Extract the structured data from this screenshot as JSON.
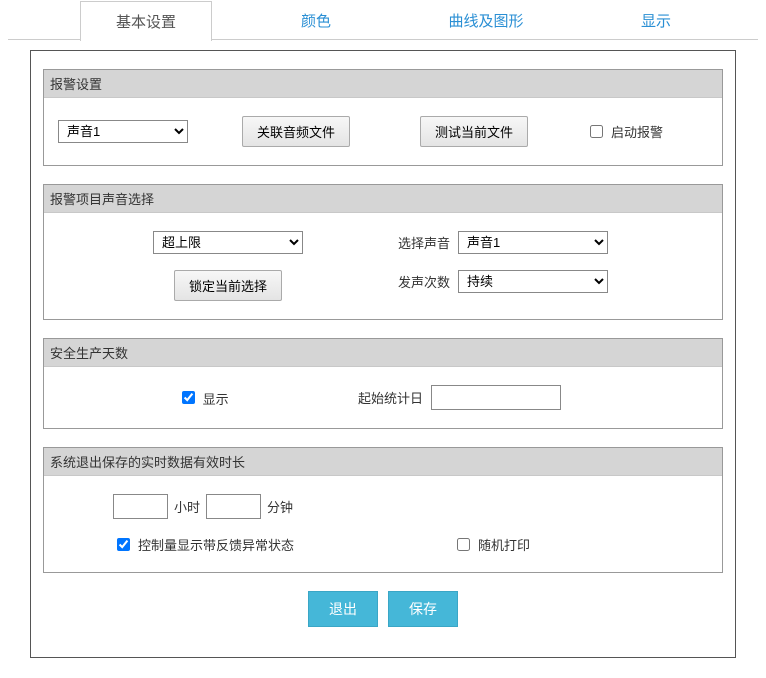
{
  "tabs": {
    "basic": "基本设置",
    "color": "颜色",
    "curve": "曲线及图形",
    "display": "显示"
  },
  "groups": {
    "alarm": {
      "title": "报警设置",
      "sound_select": "声音1",
      "link_audio_btn": "关联音频文件",
      "test_btn": "测试当前文件",
      "enable_label": "启动报警"
    },
    "alarm_sound": {
      "title": "报警项目声音选择",
      "type_select": "超上限",
      "lock_btn": "锁定当前选择",
      "select_sound_label": "选择声音",
      "select_sound_value": "声音1",
      "count_label": "发声次数",
      "count_value": "持续"
    },
    "safe_days": {
      "title": "安全生产天数",
      "show_label": "显示",
      "start_date_label": "起始统计日",
      "start_date_value": ""
    },
    "realtime": {
      "title": "系统退出保存的实时数据有效时长",
      "hours_value": "",
      "hours_label": "小时",
      "minutes_value": "",
      "minutes_label": "分钟",
      "feedback_label": "控制量显示带反馈异常状态",
      "random_print_label": "随机打印"
    }
  },
  "actions": {
    "exit": "退出",
    "save": "保存"
  },
  "state": {
    "show_safe_days_checked": true,
    "feedback_checked": true,
    "enable_alarm_checked": false,
    "random_print_checked": false
  }
}
